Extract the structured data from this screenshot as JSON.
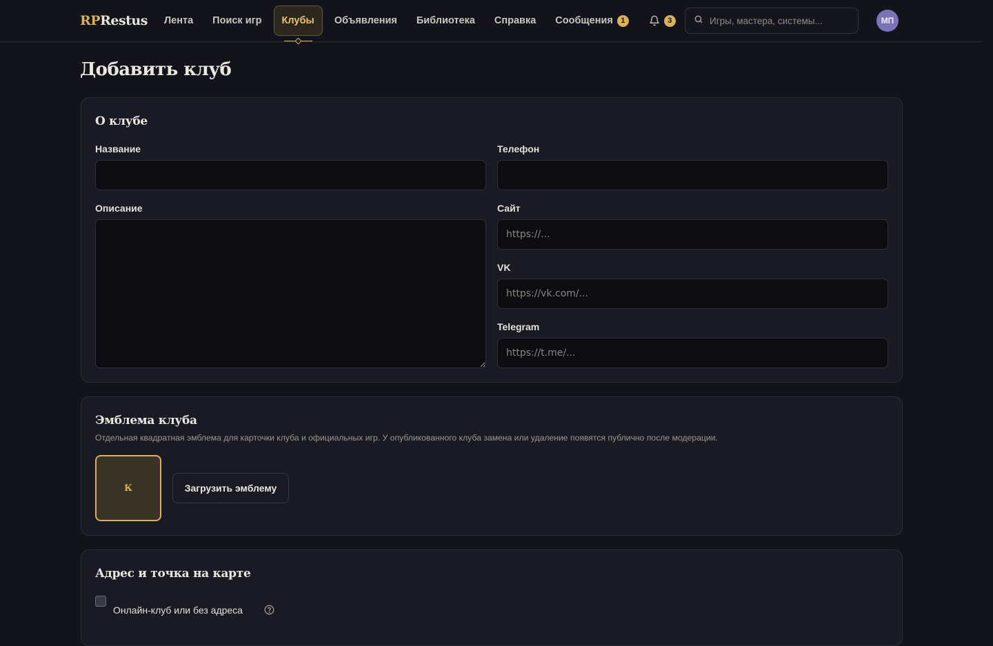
{
  "header": {
    "logo_accent": "RP",
    "logo_main": "Restus",
    "nav": [
      {
        "label": "Лента"
      },
      {
        "label": "Поиск игр"
      },
      {
        "label": "Клубы"
      },
      {
        "label": "Объявления"
      },
      {
        "label": "Библиотека"
      },
      {
        "label": "Справка"
      },
      {
        "label": "Сообщения",
        "badge": "1"
      }
    ],
    "active_nav": "Клубы",
    "notifications_badge": "3",
    "search_placeholder": "Игры, мастера, системы...",
    "avatar_initials": "МП"
  },
  "page": {
    "title": "Добавить клуб"
  },
  "about": {
    "title": "О клубе",
    "name_label": "Название",
    "name_value": "",
    "phone_label": "Телефон",
    "phone_value": "",
    "description_label": "Описание",
    "description_value": "",
    "site_label": "Сайт",
    "site_placeholder": "https://...",
    "vk_label": "VK",
    "vk_placeholder": "https://vk.com/...",
    "telegram_label": "Telegram",
    "telegram_placeholder": "https://t.me/..."
  },
  "emblem": {
    "title": "Эмблема клуба",
    "description": "Отдельная квадратная эмблема для карточки клуба и официальных игр. У опубликованного клуба замена или удаление появятся публично после модерации.",
    "placeholder_letter": "К",
    "upload_label": "Загрузить эмблему"
  },
  "address": {
    "title": "Адрес и точка на карте",
    "online_checkbox_label": "Онлайн-клуб или без адреса",
    "online_checked": false
  },
  "colors": {
    "background": "#13131c",
    "card": "#1a1a24",
    "accent": "#d9b25a",
    "avatar": "#7b72b8"
  }
}
